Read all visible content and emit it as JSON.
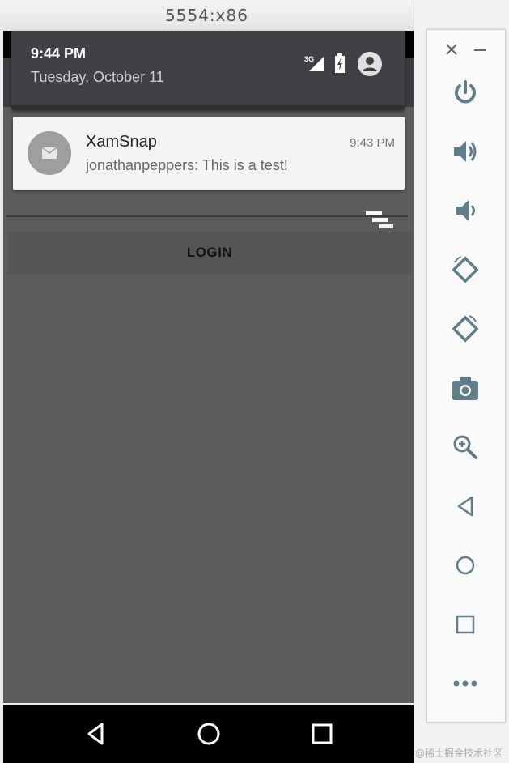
{
  "window": {
    "title": "5554:x86"
  },
  "shade": {
    "time": "9:44 PM",
    "date": "Tuesday, October 11",
    "network": "3G",
    "icons": [
      "signal-icon",
      "battery-icon",
      "account-icon"
    ]
  },
  "notification": {
    "app": "XamSnap",
    "time": "9:43 PM",
    "text": "jonathanpeppers: This is a test!",
    "icon": "mail-icon"
  },
  "app": {
    "login_label": "LOGIN",
    "menu_icon": "overflow-menu-icon"
  },
  "navbar": {
    "icons": [
      "back-icon",
      "home-icon",
      "recents-icon"
    ]
  },
  "side_toolbar": {
    "icons": [
      "close-icon",
      "minimize-icon",
      "power-icon",
      "volume-up-icon",
      "volume-down-icon",
      "rotate-left-icon",
      "rotate-right-icon",
      "camera-icon",
      "zoom-icon",
      "back-icon",
      "home-icon",
      "overview-icon",
      "more-icon"
    ]
  },
  "watermark": "@稀土掘金技术社区",
  "colors": {
    "screen_bg": "#5c5c5c",
    "shade_header": "#3f4145",
    "notification_card": "#f4f4f4",
    "icon_gray": "#607d8b"
  }
}
